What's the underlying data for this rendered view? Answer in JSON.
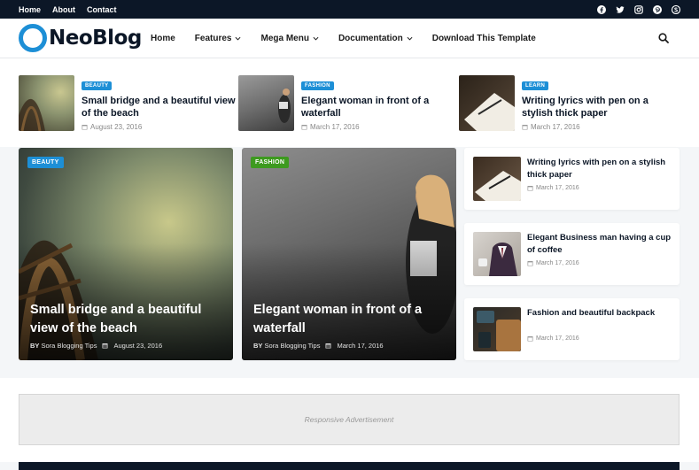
{
  "topbar": {
    "links": [
      "Home",
      "About",
      "Contact"
    ],
    "social": [
      "facebook-icon",
      "twitter-icon",
      "instagram-icon",
      "pinterest-icon",
      "skype-icon"
    ]
  },
  "header": {
    "logo": "NeoBlog",
    "nav": [
      {
        "label": "Home",
        "dropdown": false
      },
      {
        "label": "Features",
        "dropdown": true
      },
      {
        "label": "Mega Menu",
        "dropdown": true
      },
      {
        "label": "Documentation",
        "dropdown": true
      },
      {
        "label": "Download This Template",
        "dropdown": false
      }
    ],
    "search_icon": "search-icon"
  },
  "ticker": [
    {
      "badge": "Beauty",
      "title": "Small bridge and a beautiful view of the beach",
      "date": "August 23, 2016",
      "color": "#1d8fd6"
    },
    {
      "badge": "Fashion",
      "title": "Elegant woman in front of a waterfall",
      "date": "March 17, 2016",
      "color": "#1d8fd6"
    },
    {
      "badge": "Learn",
      "title": "Writing lyrics with pen on a stylish thick paper",
      "date": "March 17, 2016",
      "color": "#1d8fd6"
    }
  ],
  "featured": [
    {
      "badge": "Beauty",
      "title": "Small bridge and a beautiful view of the beach",
      "by": "BY",
      "author": "Sora Blogging Tips",
      "date": "August 23, 2016",
      "color": "#1d8fd6"
    },
    {
      "badge": "Fashion",
      "title": "Elegant woman in front of a waterfall",
      "by": "BY",
      "author": "Sora Blogging Tips",
      "date": "March 17, 2016",
      "color": "#3d9a1f"
    }
  ],
  "side_posts": [
    {
      "title": "Writing lyrics with pen on a stylish thick paper",
      "date": "March 17, 2016"
    },
    {
      "title": "Elegant Business man having a cup of coffee",
      "date": "March 17, 2016"
    },
    {
      "title": "Fashion and beautiful backpack",
      "date": "March 17, 2016"
    }
  ],
  "ad": {
    "label": "Responsive Advertisement"
  },
  "colors": {
    "accent": "#1d8fd6",
    "dark": "#0c1727",
    "green": "#3d9a1f"
  }
}
